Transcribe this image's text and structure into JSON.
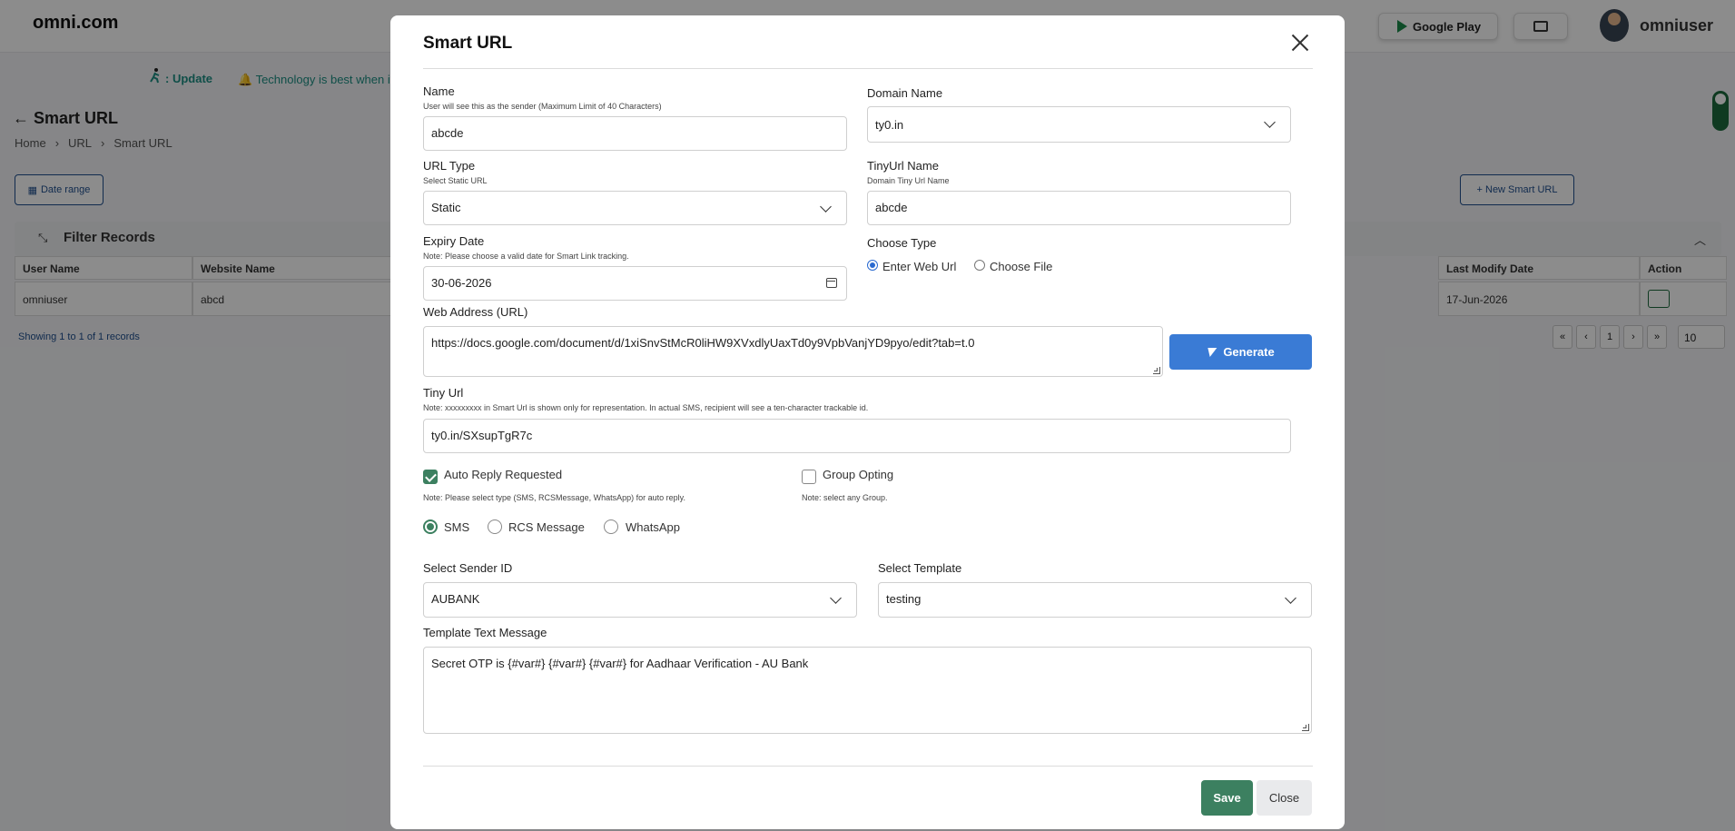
{
  "bg": {
    "brand": "omni.com",
    "google_play": "Google Play",
    "username": "omniuser",
    "ticker_prefix": ": Update",
    "ticker_text": "Technology is best when it br",
    "page_title": "Smart URL",
    "breadcrumb": [
      "Home",
      "URL",
      "Smart URL"
    ],
    "date_range": "Date range",
    "new_smart_url": "+ New Smart URL",
    "filter_title": "Filter Records",
    "columns": {
      "user": "User Name",
      "website": "Website Name",
      "modify": "Last Modify Date",
      "action": "Action"
    },
    "row": {
      "user": "omniuser",
      "website": "abcd",
      "modify": "17-Jun-2026"
    },
    "showing": "Showing 1 to 1 of 1 records",
    "pager": [
      "«",
      "‹",
      "1",
      "›",
      "»"
    ],
    "page_size": "10"
  },
  "modal": {
    "title": "Smart URL",
    "name": {
      "label": "Name",
      "hint": "User will see this as the sender (Maximum Limit of 40 Characters)",
      "value": "abcde"
    },
    "domain": {
      "label": "Domain Name",
      "value": "ty0.in"
    },
    "url_type": {
      "label": "URL Type",
      "hint": "Select Static URL",
      "value": "Static"
    },
    "tinyurl_name": {
      "label": "TinyUrl Name",
      "hint": "Domain Tiny Url Name",
      "value": "abcde"
    },
    "expiry": {
      "label": "Expiry Date",
      "hint": "Note: Please choose a valid date for Smart Link tracking.",
      "value": "30-06-2026"
    },
    "choose_type": {
      "label": "Choose Type",
      "options": [
        "Enter Web Url",
        "Choose File"
      ],
      "selected": "Enter Web Url"
    },
    "web_address": {
      "label": "Web Address (URL)",
      "value": "https://docs.google.com/document/d/1xiSnvStMcR0liHW9XVxdlyUaxTd0y9VpbVanjYD9pyo/edit?tab=t.0"
    },
    "generate": "Generate",
    "tiny_url": {
      "label": "Tiny Url",
      "hint": "Note: xxxxxxxxx in Smart Url is shown only for representation. In actual SMS, recipient will see a ten-character trackable id.",
      "value": "ty0.in/SXsupTgR7c"
    },
    "auto_reply": {
      "label": "Auto Reply Requested",
      "hint": "Note: Please select type (SMS, RCSMessage, WhatsApp) for auto reply.",
      "checked": true
    },
    "group_opting": {
      "label": "Group Opting",
      "hint": "Note: select any Group.",
      "checked": false
    },
    "channels": {
      "options": [
        "SMS",
        "RCS Message",
        "WhatsApp"
      ],
      "selected": "SMS"
    },
    "sender_id": {
      "label": "Select Sender ID",
      "value": "AUBANK"
    },
    "template": {
      "label": "Select Template",
      "value": "testing"
    },
    "template_text": {
      "label": "Template Text Message",
      "value": "Secret OTP is {#var#} {#var#} {#var#} for Aadhaar Verification - AU Bank"
    },
    "save": "Save",
    "close": "Close"
  },
  "colors": {
    "accent": "#3a7bd5",
    "success": "#3c8060",
    "link": "#1f4f8f"
  }
}
